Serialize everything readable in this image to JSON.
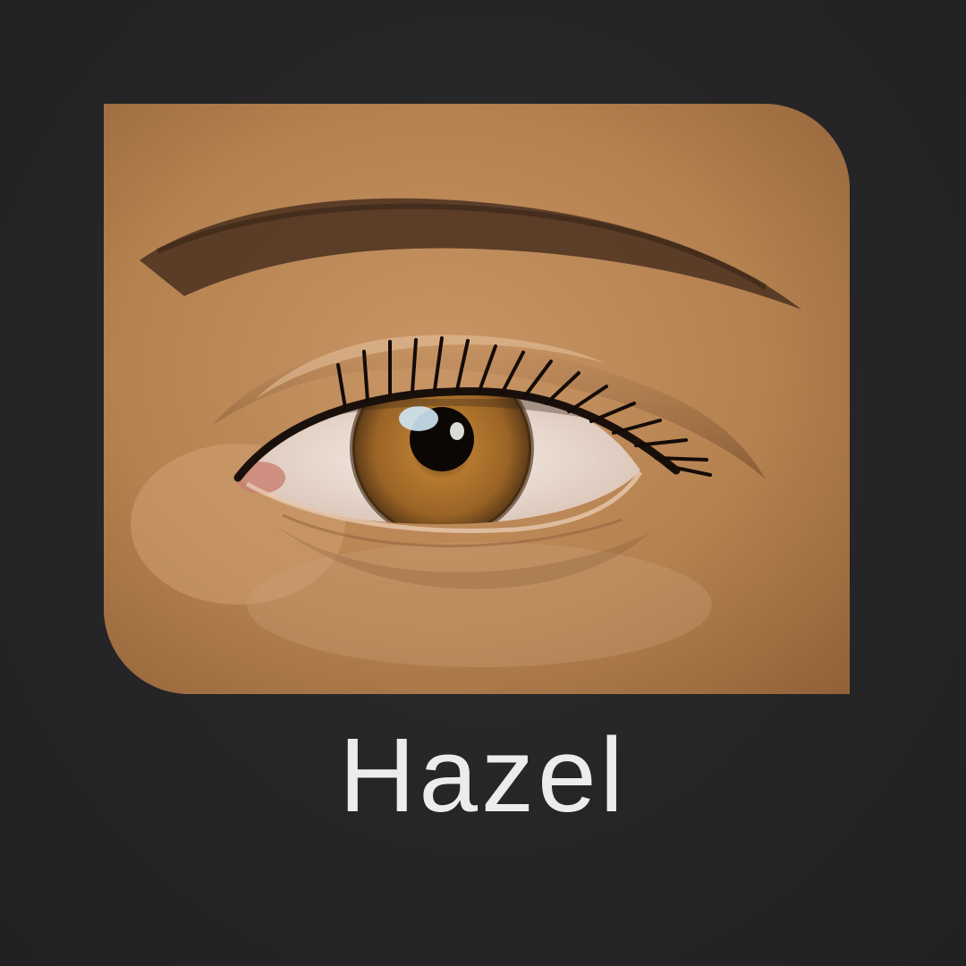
{
  "product": {
    "color_name": "Hazel"
  },
  "colors": {
    "background": "#262527",
    "label": "#ececec",
    "skin": "#b98656",
    "iris": "#9a6426"
  },
  "icons": {
    "photo": "eye-closeup-photo"
  }
}
